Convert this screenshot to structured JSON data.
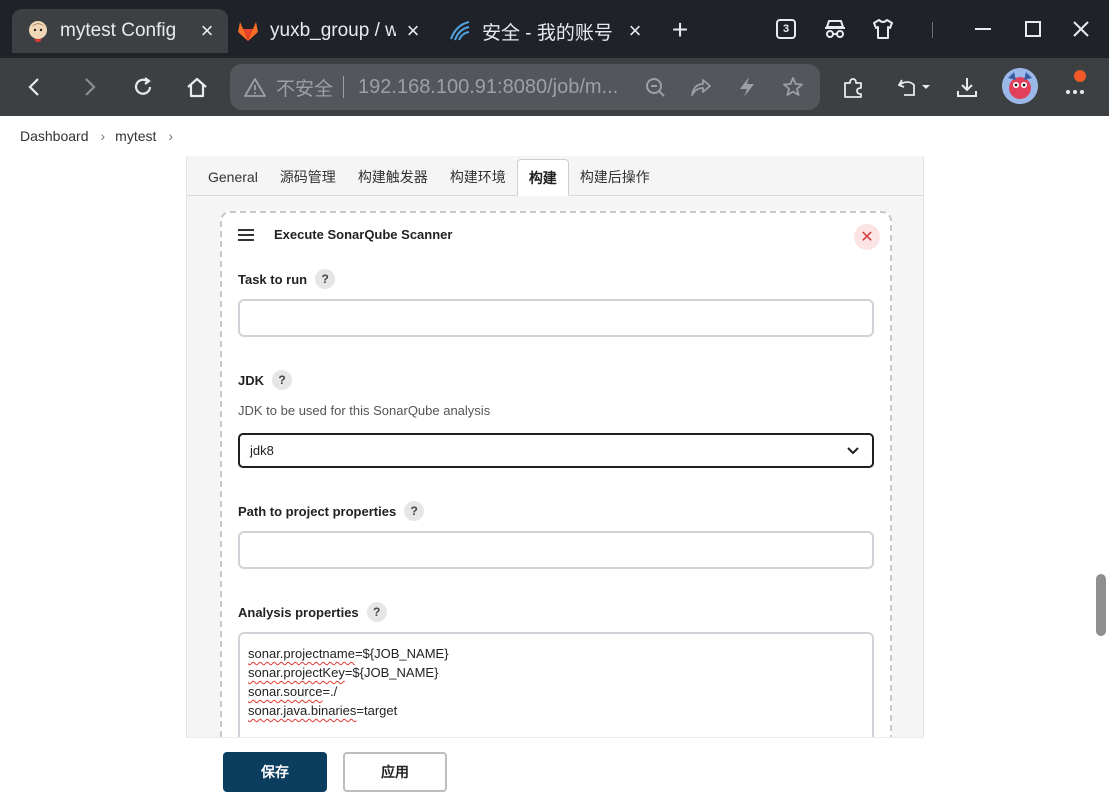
{
  "browser": {
    "tabs": [
      {
        "title": "mytest Config",
        "active": true
      },
      {
        "title": "yuxb_group / w",
        "active": false
      },
      {
        "title": "安全 - 我的账号",
        "active": false
      }
    ],
    "tab_count": "3",
    "address": {
      "security_label": "不安全",
      "url": "192.168.100.91:8080/job/m..."
    }
  },
  "breadcrumb": [
    {
      "label": "Dashboard"
    },
    {
      "label": "mytest"
    }
  ],
  "config_tabs": [
    {
      "label": "General",
      "active": false
    },
    {
      "label": "源码管理",
      "active": false
    },
    {
      "label": "构建触发器",
      "active": false
    },
    {
      "label": "构建环境",
      "active": false
    },
    {
      "label": "构建",
      "active": true
    },
    {
      "label": "构建后操作",
      "active": false
    }
  ],
  "step": {
    "title": "Execute SonarQube Scanner",
    "close_label": "✕",
    "task_label": "Task to run",
    "task_value": "",
    "jdk_label": "JDK",
    "jdk_desc": "JDK to be used for this SonarQube analysis",
    "jdk_selected": "jdk8",
    "path_label": "Path to project properties",
    "path_value": "",
    "analysis_label": "Analysis properties",
    "analysis_lines": [
      {
        "key": "sonar.projectname",
        "value": "=${JOB_NAME}"
      },
      {
        "key": "sonar.projectKey",
        "value": "=${JOB_NAME}"
      },
      {
        "key": "sonar.source",
        "value": "=./"
      },
      {
        "key": "sonar.java.binaries",
        "value": "=target"
      }
    ]
  },
  "help_glyph": "?",
  "actions": {
    "save_label": "保存",
    "apply_label": "应用"
  }
}
